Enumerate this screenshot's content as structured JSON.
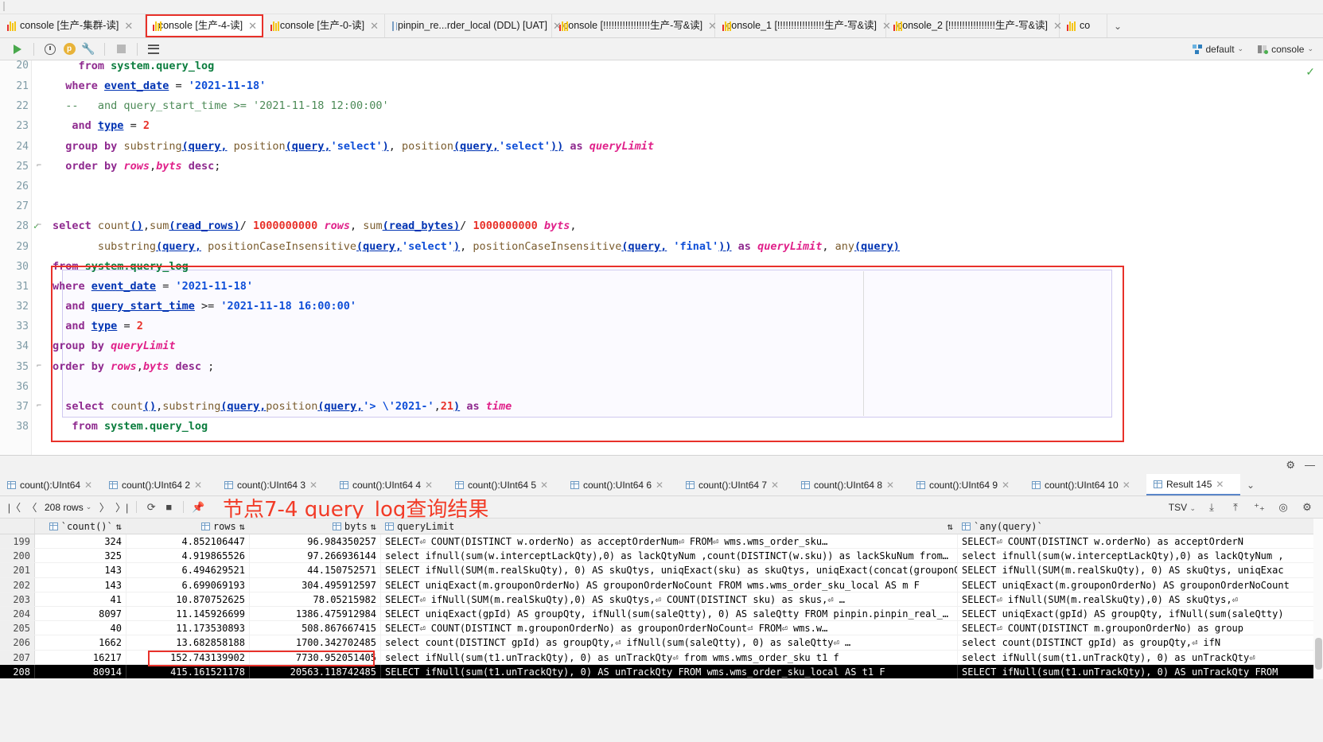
{
  "window": {
    "title": "console [生产-4-读]"
  },
  "tabs": [
    {
      "label": "console [生产-集群-读]",
      "icon": "console-icon",
      "active": false,
      "selected": false
    },
    {
      "label": "console [生产-4-读]",
      "icon": "console-icon",
      "active": true,
      "selected": true
    },
    {
      "label": "console [生产-0-读]",
      "icon": "console-icon",
      "active": false,
      "selected": false
    },
    {
      "label": "pinpin_re...rder_local (DDL) [UAT]",
      "icon": "table-icon",
      "active": false,
      "selected": false
    },
    {
      "label": "console [!!!!!!!!!!!!!!!!!生产-写&读]",
      "icon": "console-icon",
      "active": false,
      "selected": false
    },
    {
      "label": "console_1 [!!!!!!!!!!!!!!!!!生产-写&读]",
      "icon": "console-icon",
      "active": false,
      "selected": false
    },
    {
      "label": "console_2 [!!!!!!!!!!!!!!!!!生产-写&读]",
      "icon": "console-icon",
      "active": false,
      "selected": false
    },
    {
      "label": "co",
      "icon": "console-icon",
      "active": false,
      "selected": false
    }
  ],
  "tab_close_glyph": "✕",
  "tabs_overflow_glyph": "⌄",
  "toolbar": {
    "run_label": "Run",
    "history_label": "History",
    "params_label": "p",
    "settings_label": "Settings",
    "stop_label": "Stop",
    "grid_label": "Output",
    "schema_value": "default",
    "connection_value": "console",
    "caret_glyph": "⌄"
  },
  "editor": {
    "inspection_ok_glyph": "✓",
    "lines": [
      {
        "num": "20",
        "clipped": true,
        "tokens": [
          {
            "t": "    ",
            "c": "punc"
          },
          {
            "t": "from",
            "c": "kw"
          },
          {
            "t": " ",
            "c": "punc"
          },
          {
            "t": "system.query_log",
            "c": "tbl"
          }
        ]
      },
      {
        "num": "21",
        "tokens": [
          {
            "t": "  ",
            "c": "punc"
          },
          {
            "t": "where",
            "c": "kw"
          },
          {
            "t": " ",
            "c": "punc"
          },
          {
            "t": "event_date",
            "c": "col"
          },
          {
            "t": " = ",
            "c": "punc"
          },
          {
            "t": "'2021-11-18'",
            "c": "str"
          }
        ]
      },
      {
        "num": "22",
        "tokens": [
          {
            "t": "  --   and query_start_time >= '2021-11-18 12:00:00'",
            "c": "cmt"
          }
        ]
      },
      {
        "num": "23",
        "tokens": [
          {
            "t": "   ",
            "c": "punc"
          },
          {
            "t": "and",
            "c": "kw"
          },
          {
            "t": " ",
            "c": "punc"
          },
          {
            "t": "type",
            "c": "col"
          },
          {
            "t": " = ",
            "c": "punc"
          },
          {
            "t": "2",
            "c": "num2"
          }
        ]
      },
      {
        "num": "24",
        "tokens": [
          {
            "t": "  ",
            "c": "punc"
          },
          {
            "t": "group by",
            "c": "kw"
          },
          {
            "t": " ",
            "c": "punc"
          },
          {
            "t": "substring",
            "c": "fn"
          },
          {
            "t": "(query,",
            "c": "col"
          },
          {
            "t": " ",
            "c": "punc"
          },
          {
            "t": "position",
            "c": "fn"
          },
          {
            "t": "(query,",
            "c": "col"
          },
          {
            "t": "'select'",
            "c": "str"
          },
          {
            "t": ")",
            "c": "col"
          },
          {
            "t": ", ",
            "c": "punc"
          },
          {
            "t": "position",
            "c": "fn"
          },
          {
            "t": "(query,",
            "c": "col"
          },
          {
            "t": "'select'",
            "c": "str"
          },
          {
            "t": "))",
            "c": "col"
          },
          {
            "t": " as ",
            "c": "kw"
          },
          {
            "t": "queryLimit",
            "c": "alias"
          }
        ]
      },
      {
        "num": "25",
        "fold": true,
        "tokens": [
          {
            "t": "  ",
            "c": "punc"
          },
          {
            "t": "order by",
            "c": "kw"
          },
          {
            "t": " ",
            "c": "punc"
          },
          {
            "t": "rows",
            "c": "alias"
          },
          {
            "t": ",",
            "c": "punc"
          },
          {
            "t": "byts",
            "c": "alias"
          },
          {
            "t": " ",
            "c": "punc"
          },
          {
            "t": "desc",
            "c": "kw"
          },
          {
            "t": ";",
            "c": "punc"
          }
        ]
      },
      {
        "num": "26",
        "tokens": []
      },
      {
        "num": "27",
        "tokens": []
      },
      {
        "num": "28",
        "check": true,
        "fold": true,
        "tokens": [
          {
            "t": "select",
            "c": "kw"
          },
          {
            "t": " ",
            "c": "punc"
          },
          {
            "t": "count",
            "c": "fn"
          },
          {
            "t": "()",
            "c": "col"
          },
          {
            "t": ",",
            "c": "punc"
          },
          {
            "t": "sum",
            "c": "fn"
          },
          {
            "t": "(read_rows)",
            "c": "col"
          },
          {
            "t": "/ ",
            "c": "punc"
          },
          {
            "t": "1000000000",
            "c": "num2"
          },
          {
            "t": " ",
            "c": "punc"
          },
          {
            "t": "rows",
            "c": "alias"
          },
          {
            "t": ", ",
            "c": "punc"
          },
          {
            "t": "sum",
            "c": "fn"
          },
          {
            "t": "(read_bytes)",
            "c": "col"
          },
          {
            "t": "/ ",
            "c": "punc"
          },
          {
            "t": "1000000000",
            "c": "num2"
          },
          {
            "t": " ",
            "c": "punc"
          },
          {
            "t": "byts",
            "c": "alias"
          },
          {
            "t": ",",
            "c": "punc"
          }
        ]
      },
      {
        "num": "29",
        "tokens": [
          {
            "t": "       ",
            "c": "dot"
          },
          {
            "t": "substring",
            "c": "fn"
          },
          {
            "t": "(query,",
            "c": "col"
          },
          {
            "t": " ",
            "c": "punc"
          },
          {
            "t": "positionCaseInsensitive",
            "c": "fn"
          },
          {
            "t": "(query,",
            "c": "col"
          },
          {
            "t": "'select'",
            "c": "str"
          },
          {
            "t": ")",
            "c": "col"
          },
          {
            "t": ", ",
            "c": "punc"
          },
          {
            "t": "positionCaseInsensitive",
            "c": "fn"
          },
          {
            "t": "(query,",
            "c": "col"
          },
          {
            "t": " ",
            "c": "punc"
          },
          {
            "t": "'final'",
            "c": "str"
          },
          {
            "t": "))",
            "c": "col"
          },
          {
            "t": " as ",
            "c": "kw"
          },
          {
            "t": "queryLimit",
            "c": "alias"
          },
          {
            "t": ", ",
            "c": "punc"
          },
          {
            "t": "any",
            "c": "fn"
          },
          {
            "t": "(query)",
            "c": "col"
          }
        ]
      },
      {
        "num": "30",
        "tokens": [
          {
            "t": "from",
            "c": "kw"
          },
          {
            "t": " ",
            "c": "punc"
          },
          {
            "t": "system.query_log",
            "c": "tbl"
          }
        ]
      },
      {
        "num": "31",
        "tokens": [
          {
            "t": "where",
            "c": "kw"
          },
          {
            "t": " ",
            "c": "punc"
          },
          {
            "t": "event_date",
            "c": "col"
          },
          {
            "t": " = ",
            "c": "punc"
          },
          {
            "t": "'2021-11-18'",
            "c": "str"
          }
        ]
      },
      {
        "num": "32",
        "tokens": [
          {
            "t": "  ",
            "c": "punc"
          },
          {
            "t": "and",
            "c": "kw"
          },
          {
            "t": " ",
            "c": "punc"
          },
          {
            "t": "query_start_time",
            "c": "col"
          },
          {
            "t": " >= ",
            "c": "punc"
          },
          {
            "t": "'2021-11-18 16:00:00'",
            "c": "str"
          }
        ]
      },
      {
        "num": "33",
        "tokens": [
          {
            "t": "  ",
            "c": "punc"
          },
          {
            "t": "and",
            "c": "kw"
          },
          {
            "t": " ",
            "c": "punc"
          },
          {
            "t": "type",
            "c": "col"
          },
          {
            "t": " = ",
            "c": "punc"
          },
          {
            "t": "2",
            "c": "num2"
          }
        ]
      },
      {
        "num": "34",
        "tokens": [
          {
            "t": "group by",
            "c": "kw"
          },
          {
            "t": " ",
            "c": "punc"
          },
          {
            "t": "queryLimit",
            "c": "alias"
          }
        ]
      },
      {
        "num": "35",
        "fold": true,
        "tokens": [
          {
            "t": "order by",
            "c": "kw"
          },
          {
            "t": " ",
            "c": "punc"
          },
          {
            "t": "rows",
            "c": "alias"
          },
          {
            "t": ",",
            "c": "punc"
          },
          {
            "t": "byts",
            "c": "alias"
          },
          {
            "t": " ",
            "c": "punc"
          },
          {
            "t": "desc",
            "c": "kw"
          },
          {
            "t": " ;",
            "c": "punc"
          }
        ]
      },
      {
        "num": "36",
        "tokens": []
      },
      {
        "num": "37",
        "fold": true,
        "tokens": [
          {
            "t": "  ",
            "c": "punc"
          },
          {
            "t": "select",
            "c": "kw"
          },
          {
            "t": " ",
            "c": "punc"
          },
          {
            "t": "count",
            "c": "fn"
          },
          {
            "t": "()",
            "c": "col"
          },
          {
            "t": ",",
            "c": "punc"
          },
          {
            "t": "substring",
            "c": "fn"
          },
          {
            "t": "(query,",
            "c": "col"
          },
          {
            "t": "position",
            "c": "fn"
          },
          {
            "t": "(query,",
            "c": "col"
          },
          {
            "t": "'> \\'2021-'",
            "c": "str"
          },
          {
            "t": ",",
            "c": "punc"
          },
          {
            "t": "21",
            "c": "num2"
          },
          {
            "t": ")",
            "c": "col"
          },
          {
            "t": " as ",
            "c": "kw"
          },
          {
            "t": "time",
            "c": "alias"
          }
        ]
      },
      {
        "num": "38",
        "tokens": [
          {
            "t": "   ",
            "c": "punc"
          },
          {
            "t": "from",
            "c": "kw"
          },
          {
            "t": " ",
            "c": "punc"
          },
          {
            "t": "system.query_log",
            "c": "tbl"
          }
        ]
      }
    ]
  },
  "results": {
    "settings_glyph": "⚙",
    "minimize_glyph": "—",
    "tabs": [
      {
        "label": "count():UInt64",
        "active": false
      },
      {
        "label": "count():UInt64 2",
        "active": false
      },
      {
        "label": "count():UInt64 3",
        "active": false
      },
      {
        "label": "count():UInt64 4",
        "active": false
      },
      {
        "label": "count():UInt64 5",
        "active": false
      },
      {
        "label": "count():UInt64 6",
        "active": false
      },
      {
        "label": "count():UInt64 7",
        "active": false
      },
      {
        "label": "count():UInt64 8",
        "active": false
      },
      {
        "label": "count():UInt64 9",
        "active": false
      },
      {
        "label": "count():UInt64 10",
        "active": false
      },
      {
        "label": "Result 145",
        "active": true
      }
    ],
    "tab_close_glyph": "✕",
    "tabs_overflow_glyph": "⌄",
    "toolbar": {
      "first_glyph": "|〈",
      "prev_glyph": "〈",
      "rows_label": "208 rows",
      "rows_caret": "⌄",
      "next_glyph": "〉",
      "last_glyph": "〉|",
      "refresh_glyph": "⟳",
      "stop_glyph": "■",
      "pin_glyph": "📌",
      "format_label": "TSV",
      "format_caret": "⌄",
      "download_glyph": "⤓",
      "import_glyph": "⤒",
      "add_glyph": "⁺₊",
      "view_glyph": "◎",
      "settings_glyph": "⚙"
    },
    "annotation": "节点7-4 query_log查询结果",
    "annotation_color": "#f23b27",
    "columns": [
      {
        "key": "idx",
        "label": "",
        "sortable": false
      },
      {
        "key": "count",
        "label": "`count()`",
        "sortable": true
      },
      {
        "key": "rows",
        "label": "rows",
        "sortable": true
      },
      {
        "key": "byts",
        "label": "byts",
        "sortable": true
      },
      {
        "key": "queryLimit",
        "label": "queryLimit",
        "sortable": true
      },
      {
        "key": "anyquery",
        "label": "`any(query)`",
        "sortable": false
      }
    ],
    "sort_glyph": "⇅",
    "rows": [
      {
        "idx": "199",
        "count": "324",
        "rows": "4.852106447",
        "byts": "96.984350257",
        "queryLimit": "SELECT⏎        COUNT(DISTINCT w.orderNo) as acceptOrderNum⏎        FROM⏎        wms.wms_order_sku…",
        "anyquery": "SELECT⏎          COUNT(DISTINCT w.orderNo) as acceptOrderN",
        "selected": false
      },
      {
        "idx": "200",
        "count": "325",
        "rows": "4.919865526",
        "byts": "97.266936144",
        "queryLimit": "select ifnull(sum(w.interceptLackQty),0) as lackQtyNum ,count(DISTINCT(w.sku)) as lackSkuNum from…",
        "anyquery": "select ifnull(sum(w.interceptLackQty),0) as lackQtyNum ,",
        "selected": false
      },
      {
        "idx": "201",
        "count": "143",
        "rows": "6.494629521",
        "byts": "44.150752571",
        "queryLimit": "SELECT ifNull(SUM(m.realSkuQty), 0) AS skuQtys, uniqExact(sku) as skuQtys, uniqExact(concat(grouponO…",
        "anyquery": "SELECT ifNull(SUM(m.realSkuQty), 0) AS skuQtys, uniqExac",
        "selected": false
      },
      {
        "idx": "202",
        "count": "143",
        "rows": "6.699069193",
        "byts": "304.495912597",
        "queryLimit": "SELECT uniqExact(m.grouponOrderNo) AS grouponOrderNoCount FROM wms.wms_order_sku_local AS m F",
        "anyquery": "SELECT uniqExact(m.grouponOrderNo) AS grouponOrderNoCount",
        "selected": false
      },
      {
        "idx": "203",
        "count": "41",
        "rows": "10.870752625",
        "byts": "78.05215982",
        "queryLimit": "SELECT⏎        ifNull(SUM(m.realSkuQty),0) AS skuQtys,⏎        COUNT(DISTINCT sku) as skus,⏎     …",
        "anyquery": "SELECT⏎        ifNull(SUM(m.realSkuQty),0) AS skuQtys,⏎",
        "selected": false
      },
      {
        "idx": "204",
        "count": "8097",
        "rows": "11.145926699",
        "byts": "1386.475912984",
        "queryLimit": "SELECT uniqExact(gpId) AS groupQty, ifNull(sum(saleQtty), 0) AS saleQtty FROM pinpin.pinpin_real_…",
        "anyquery": "SELECT uniqExact(gpId) AS groupQty, ifNull(sum(saleQtty)",
        "selected": false
      },
      {
        "idx": "205",
        "count": "40",
        "rows": "11.173530893",
        "byts": "508.867667415",
        "queryLimit": "SELECT⏎        COUNT(DISTINCT m.grouponOrderNo) as grouponOrderNoCount⏎        FROM⏎        wms.w…",
        "anyquery": "SELECT⏎         COUNT(DISTINCT m.grouponOrderNo) as group",
        "selected": false
      },
      {
        "idx": "206",
        "count": "1662",
        "rows": "13.682858188",
        "byts": "1700.342702485",
        "queryLimit": "select count(DISTINCT gpId)     as groupQty,⏎        ifNull(sum(saleQtty), 0) as saleQtty⏎     …",
        "anyquery": "select count(DISTINCT gpId)      as groupQty,⏎          ifN",
        "selected": false
      },
      {
        "idx": "207",
        "count": "16217",
        "rows": "152.743139902",
        "byts": "7730.952051405",
        "queryLimit": "select ifNull(sum(t1.unTrackQty), 0) as unTrackQty⏎          from wms.wms_order_sku t1 f",
        "anyquery": "select ifNull(sum(t1.unTrackQty), 0) as unTrackQty⏎",
        "selected": false
      },
      {
        "idx": "208",
        "count": "80914",
        "rows": "415.161521178",
        "byts": "20563.118742485",
        "queryLimit": "SELECT ifNull(sum(t1.unTrackQty), 0) AS unTrackQty FROM wms.wms_order_sku_local AS t1 F",
        "anyquery": "SELECT ifNull(sum(t1.unTrackQty), 0) AS unTrackQty FROM",
        "selected": true
      }
    ]
  }
}
